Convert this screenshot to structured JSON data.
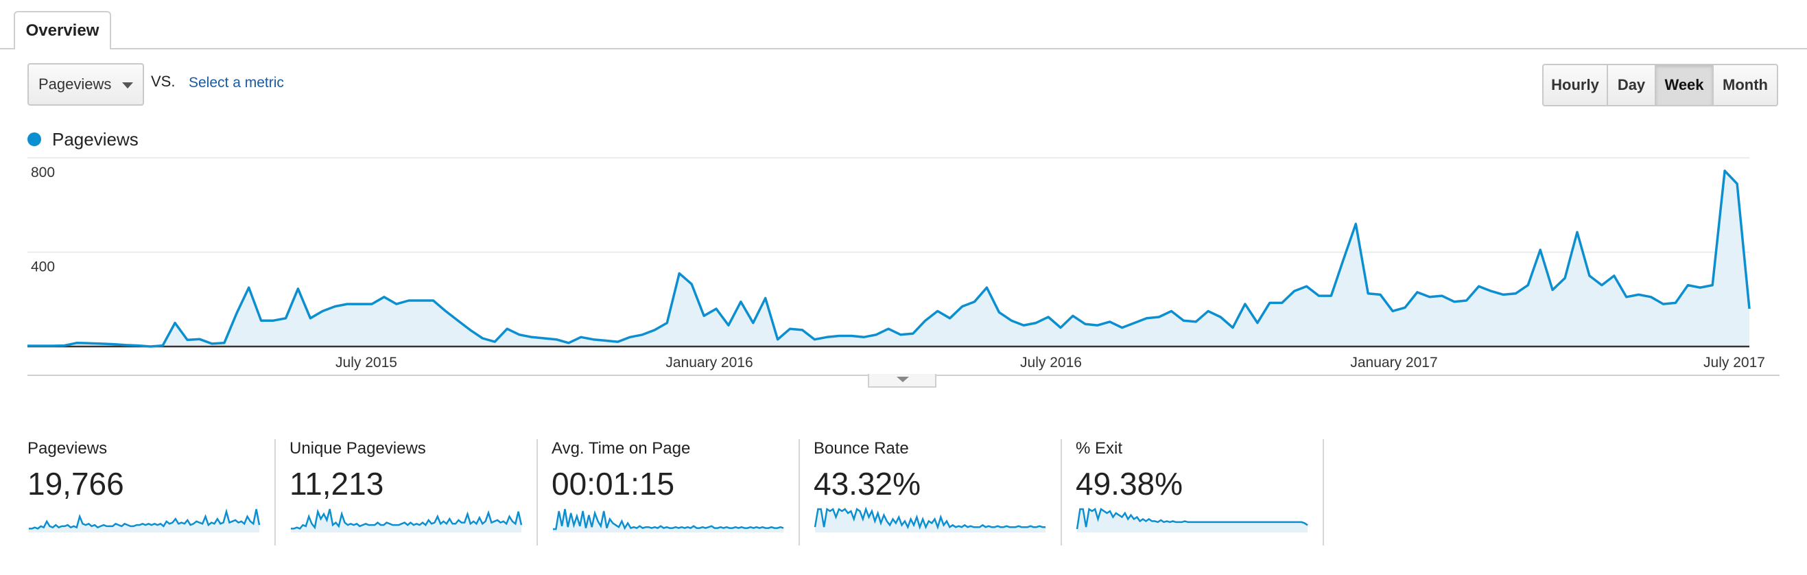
{
  "tabs": {
    "overview_label": "Overview"
  },
  "controls": {
    "metric_selected": "Pageviews",
    "vs_label": "VS.",
    "select_metric_label": "Select a metric",
    "intervals": [
      "Hourly",
      "Day",
      "Week",
      "Month"
    ],
    "active_interval": "Week"
  },
  "colors": {
    "series": "#0b8fd0",
    "fill": "#e4f1f8",
    "grid": "#e6e6e6"
  },
  "chart_data": {
    "type": "area",
    "series": [
      {
        "name": "Pageviews",
        "values": [
          3,
          3,
          3,
          4,
          15,
          14,
          12,
          10,
          6,
          4,
          0,
          4,
          100,
          28,
          31,
          12,
          15,
          140,
          250,
          110,
          110,
          120,
          245,
          120,
          150,
          170,
          180,
          180,
          180,
          210,
          180,
          195,
          195,
          195,
          150,
          110,
          70,
          35,
          20,
          75,
          50,
          40,
          35,
          30,
          15,
          40,
          30,
          25,
          20,
          40,
          50,
          70,
          100,
          310,
          265,
          130,
          160,
          90,
          190,
          100,
          205,
          30,
          75,
          70,
          30,
          40,
          45,
          45,
          40,
          50,
          75,
          50,
          55,
          110,
          150,
          120,
          170,
          190,
          250,
          145,
          110,
          90,
          100,
          125,
          80,
          130,
          95,
          90,
          105,
          80,
          100,
          120,
          125,
          150,
          110,
          105,
          150,
          125,
          80,
          180,
          100,
          185,
          185,
          235,
          255,
          215,
          215,
          370,
          520,
          225,
          220,
          150,
          165,
          230,
          210,
          215,
          190,
          195,
          255,
          235,
          220,
          225,
          260,
          410,
          240,
          290,
          485,
          300,
          260,
          300,
          210,
          220,
          210,
          180,
          185,
          260,
          250,
          260,
          745,
          690,
          160
        ]
      }
    ],
    "x_tick_labels": [
      "July 2015",
      "January 2016",
      "July 2016",
      "January 2017",
      "July 2017"
    ],
    "y_tick_labels": [
      "800",
      "400"
    ],
    "ylim": [
      0,
      800
    ],
    "grid": true
  },
  "metrics": [
    {
      "name": "Pageviews",
      "value": "19,766",
      "spark": [
        2,
        2,
        3,
        2,
        4,
        3,
        8,
        4,
        3,
        5,
        3,
        4,
        4,
        5,
        3,
        4,
        3,
        12,
        6,
        5,
        6,
        4,
        5,
        3,
        4,
        5,
        4,
        4,
        4,
        6,
        5,
        4,
        6,
        5,
        4,
        4,
        5,
        5,
        6,
        5,
        6,
        5,
        6,
        5,
        6,
        4,
        8,
        6,
        7,
        10,
        6,
        7,
        6,
        9,
        5,
        6,
        8,
        7,
        6,
        12,
        5,
        7,
        6,
        10,
        6,
        7,
        16,
        7,
        8,
        9,
        7,
        8,
        6,
        12,
        8,
        6,
        18,
        5
      ]
    },
    {
      "name": "Unique Pageviews",
      "value": "11,213",
      "spark": [
        2,
        2,
        3,
        2,
        5,
        4,
        12,
        6,
        3,
        16,
        10,
        14,
        9,
        18,
        5,
        7,
        4,
        14,
        7,
        5,
        6,
        5,
        6,
        4,
        5,
        6,
        5,
        5,
        5,
        7,
        5,
        5,
        7,
        6,
        5,
        5,
        5,
        6,
        7,
        5,
        7,
        5,
        6,
        5,
        7,
        5,
        9,
        6,
        7,
        12,
        6,
        8,
        6,
        10,
        6,
        6,
        9,
        7,
        7,
        14,
        6,
        8,
        6,
        11,
        6,
        8,
        15,
        7,
        8,
        9,
        7,
        8,
        6,
        12,
        8,
        6,
        16,
        5
      ]
    },
    {
      "name": "Avg. Time on Page",
      "value": "00:01:15",
      "spark": [
        2,
        2,
        20,
        5,
        22,
        4,
        18,
        6,
        15,
        5,
        20,
        3,
        16,
        4,
        18,
        10,
        5,
        20,
        3,
        12,
        8,
        6,
        4,
        10,
        3,
        8,
        3,
        4,
        3,
        5,
        3,
        4,
        4,
        3,
        4,
        3,
        5,
        3,
        4,
        3,
        3,
        4,
        3,
        4,
        3,
        4,
        3,
        5,
        3,
        3,
        4,
        3,
        4,
        5,
        3,
        3,
        4,
        3,
        4,
        3,
        3,
        4,
        3,
        4,
        3,
        3,
        4,
        3,
        4,
        3,
        4,
        3,
        3,
        4,
        3,
        3,
        4,
        3
      ]
    },
    {
      "name": "Bounce Rate",
      "value": "43.32%",
      "spark": [
        4,
        22,
        22,
        4,
        22,
        20,
        22,
        14,
        22,
        20,
        22,
        18,
        20,
        12,
        22,
        20,
        12,
        22,
        14,
        20,
        10,
        18,
        8,
        16,
        10,
        6,
        12,
        8,
        14,
        6,
        10,
        4,
        12,
        6,
        14,
        4,
        12,
        4,
        10,
        8,
        12,
        4,
        14,
        6,
        10,
        4,
        6,
        4,
        5,
        4,
        6,
        4,
        5,
        4,
        4,
        4,
        6,
        4,
        5,
        4,
        4,
        5,
        4,
        4,
        5,
        4,
        4,
        4,
        5,
        4,
        4,
        4,
        5,
        4,
        4,
        5,
        4,
        4
      ]
    },
    {
      "name": "% Exit",
      "value": "49.38%",
      "spark": [
        2,
        22,
        22,
        4,
        22,
        20,
        22,
        12,
        22,
        20,
        18,
        20,
        14,
        18,
        16,
        14,
        18,
        12,
        16,
        12,
        14,
        10,
        12,
        10,
        12,
        10,
        10,
        9,
        11,
        9,
        10,
        9,
        10,
        9,
        9,
        9,
        10,
        9,
        9,
        9,
        9,
        9,
        9,
        9,
        9,
        9,
        9,
        9,
        9,
        9,
        9,
        9,
        9,
        9,
        9,
        9,
        9,
        9,
        9,
        9,
        9,
        9,
        9,
        9,
        9,
        9,
        9,
        9,
        9,
        9,
        9,
        9,
        9,
        9,
        9,
        9,
        8,
        6
      ]
    }
  ]
}
